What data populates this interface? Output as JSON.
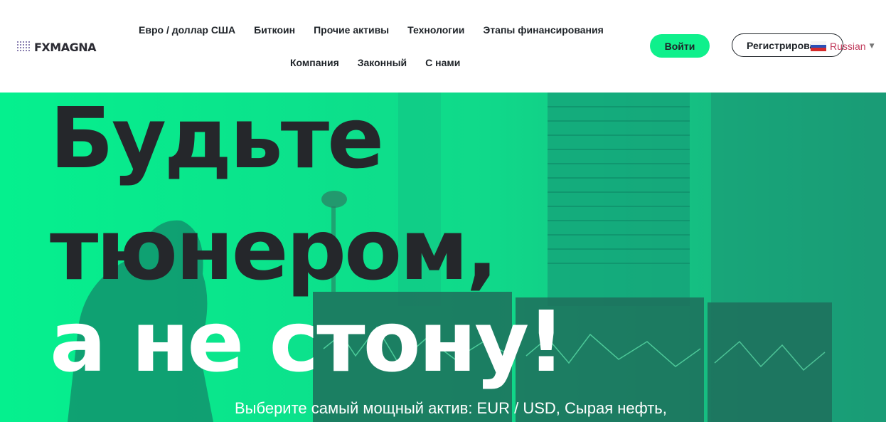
{
  "brand": {
    "logo_text": "FXMAGNA"
  },
  "nav": {
    "row1": [
      "Евро / доллар США",
      "Биткоин",
      "Прочие активы",
      "Технологии",
      "Этапы финансирования"
    ],
    "row2": [
      "Компания",
      "Законный",
      "С нами"
    ]
  },
  "header": {
    "login_label": "Войти",
    "register_label": "Регистрировать",
    "language_label": "Russian"
  },
  "hero": {
    "line1": "Будьте",
    "line2": "тюнером,",
    "line3": "а не стону!",
    "subtitle": "Выберите самый мощный актив: EUR / USD, Сырая нефть,"
  },
  "colors": {
    "accent": "#0ff08c",
    "hero_green": "#00f28c",
    "hero_dark_text": "#25272b",
    "language_text": "#c0395a"
  },
  "icons": {
    "flag": "russia-flag-icon",
    "caret": "caret-down-icon",
    "logo_mark": "dot-grid-logo-icon"
  }
}
